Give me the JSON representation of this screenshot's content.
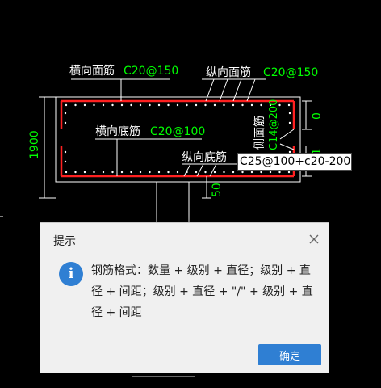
{
  "colors": {
    "background": "#000000",
    "outline": "#ffffff",
    "rebar": "#ff2020",
    "dim_text": "#00ff00",
    "label_text": "#ffffff",
    "spec_text": "#00ff00",
    "dialog_bg": "#f0f0f0",
    "accent": "#2f7fd3"
  },
  "drawing": {
    "top_transverse_label": "横向面筋",
    "top_transverse_spec": "C20@150",
    "top_longitudinal_label": "纵向面筋",
    "top_longitudinal_spec": "C20@150",
    "bottom_transverse_label": "横向底筋",
    "bottom_transverse_spec": "C20@100",
    "bottom_longitudinal_label": "纵向底筋",
    "side_label": "侧面筋",
    "side_spec": "C14@200",
    "dim_height": "1900",
    "dim_top_cover": "0",
    "dim_side_fragment": "1",
    "dim_bottom_cover": "50"
  },
  "input": {
    "value": "C25@100+c20-200"
  },
  "dialog": {
    "title": "提示",
    "message": "钢筋格式：数量 + 级别 + 直径；级别 + 直\n径 + 间距；级别 + 直径 + \"/\" + 级别 + 直\n径 + 间距",
    "ok_label": "确定",
    "info_icon": "info-icon",
    "close_icon": "close-icon"
  }
}
